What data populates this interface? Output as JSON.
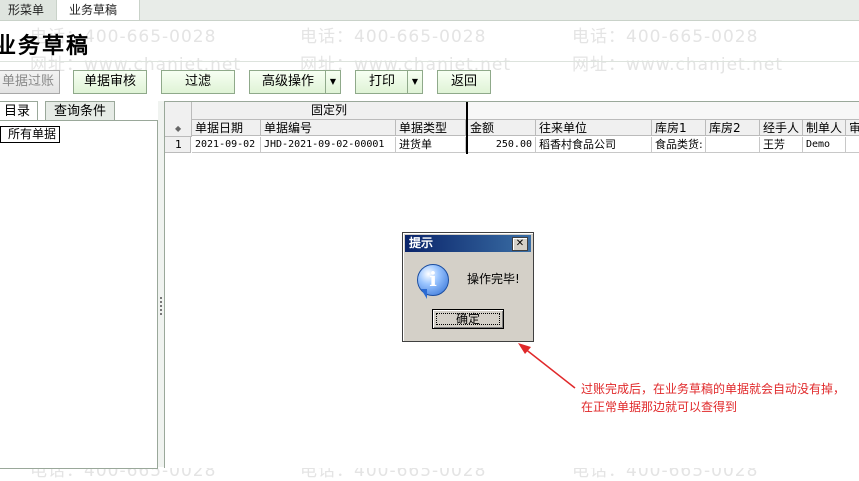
{
  "tabs": {
    "tab1": "形菜单",
    "tab2": "业务草稿"
  },
  "page_title": "业务草稿",
  "toolbar": {
    "post": "单据过账",
    "audit": "单据审核",
    "filter": "过滤",
    "advanced": "高级操作",
    "print": "打印",
    "back": "返回",
    "dropdown_arrow": "▼"
  },
  "left_tabs": {
    "catalog": "目录",
    "query": "查询条件"
  },
  "tree": {
    "root": "所有单据"
  },
  "grid": {
    "fixed_caption": "固定列",
    "corner_mark": "◆",
    "columns": [
      "单据日期",
      "单据编号",
      "单据类型",
      "金额",
      "往来单位",
      "库房1",
      "库房2",
      "经手人",
      "制单人",
      "审"
    ],
    "rows": [
      {
        "num": "1",
        "date": "2021-09-02",
        "code": "JHD-2021-09-02-00001",
        "type": "进货单",
        "amount": "250.00",
        "partner": "稻香村食品公司",
        "store1": "食品类货:",
        "store2": "",
        "handler": "王芳",
        "maker": "Demo",
        "audit": ""
      }
    ]
  },
  "watermark": {
    "phone": "电话：400-665-0028",
    "site": "网址：www.chanjet.net"
  },
  "dialog": {
    "title": "提示",
    "close": "✕",
    "icon_glyph": "i",
    "message": "操作完毕!",
    "ok": "确定"
  },
  "annotation": {
    "line1": "过账完成后，在业务草稿的单据就会自动没有掉，",
    "line2": "在正常单据那边就可以查得到"
  },
  "colors": {
    "annotation": "#e0282a",
    "dialog_title": "#0a246a",
    "toolbar_button": "#dff3d6"
  }
}
